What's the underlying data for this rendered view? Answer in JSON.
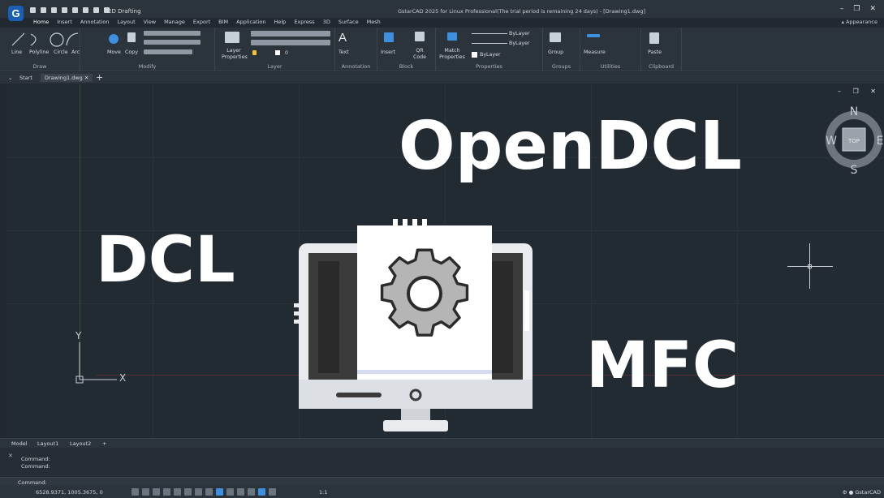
{
  "app": {
    "logo_letter": "G",
    "workspace": "2D Drafting",
    "title": "GstarCAD 2025 for Linux Professional(The trial period is remaining 24 days) - [Drawing1.dwg]",
    "appearance_label": "Appearance",
    "window_controls": [
      "–",
      "❐",
      "✕"
    ]
  },
  "ribbon_tabs": [
    "Home",
    "Insert",
    "Annotation",
    "Layout",
    "View",
    "Manage",
    "Export",
    "BIM",
    "Application",
    "Help",
    "Express",
    "3D",
    "Surface",
    "Mesh"
  ],
  "ribbon": {
    "draw": {
      "label": "Draw",
      "tools": [
        "Line",
        "Polyline",
        "Circle",
        "Arc"
      ]
    },
    "modify": {
      "label": "Modify",
      "tools": [
        "Move",
        "Copy"
      ]
    },
    "layer": {
      "label": "Layer",
      "tools": [
        "Layer Properties"
      ],
      "current_layer": "0"
    },
    "annotation": {
      "label": "Annotation",
      "tools": [
        "Text"
      ]
    },
    "block": {
      "label": "Block",
      "tools": [
        "Insert",
        "QR Code"
      ]
    },
    "properties": {
      "label": "Properties",
      "tools": [
        "Match Properties"
      ],
      "color": "ByLayer",
      "linetype": "ByLayer",
      "lineweight": "ByLayer"
    },
    "groups": {
      "label": "Groups",
      "tools": [
        "Group"
      ]
    },
    "utilities": {
      "label": "Utilities",
      "tools": [
        "Measure"
      ]
    },
    "clipboard": {
      "label": "Clipboard",
      "tools": [
        "Paste"
      ]
    }
  },
  "doc_tabs": {
    "start": "Start",
    "active": "Drawing1.dwg",
    "close": "✕",
    "add": "+"
  },
  "canvas": {
    "words": {
      "opendcl": "OpenDCL",
      "dcl": "DCL",
      "mfc": "MFC"
    },
    "ucs": {
      "x_label": "X",
      "y_label": "Y"
    },
    "viewcube": {
      "n": "N",
      "s": "S",
      "e": "E",
      "w": "W",
      "top": "TOP"
    }
  },
  "layout_tabs": [
    "Model",
    "Layout1",
    "Layout2",
    "+"
  ],
  "command": {
    "history": [
      "Command:",
      "Command:"
    ],
    "prompt": "Command:"
  },
  "status": {
    "coords": "6528.9371, 1005.3675, 0",
    "scale": "1:1",
    "app_name": "GstarCAD"
  },
  "colors": {
    "canvas_bg": "#222a32",
    "panel_bg": "#2b333b",
    "accent": "#3d8fe0"
  }
}
